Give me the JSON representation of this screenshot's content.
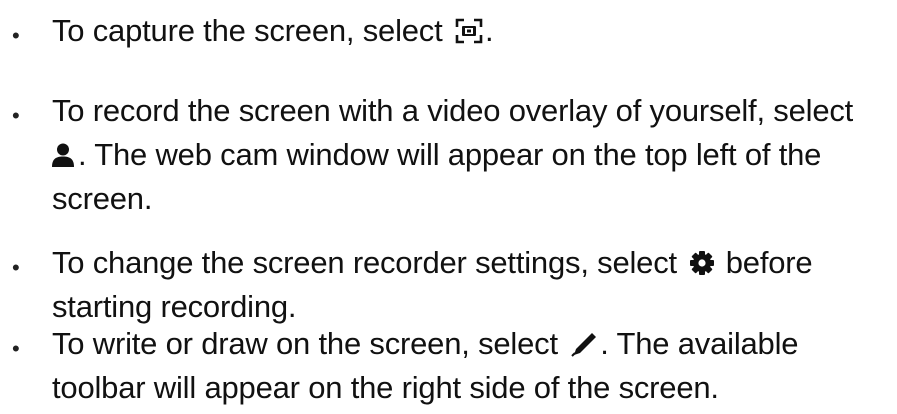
{
  "items": [
    {
      "icon": "screen-capture-icon",
      "lines": [
        {
          "before": "To capture the screen, select ",
          "after": "."
        }
      ]
    },
    {
      "icon": "person-icon",
      "lines": [
        {
          "text": "To record the screen with a video overlay of yourself, select"
        },
        {
          "before": "",
          "after": ". The web cam window will appear on the top left of the"
        },
        {
          "text": "screen."
        }
      ]
    },
    {
      "icon": "gear-icon",
      "lines": [
        {
          "before": "To change the screen recorder settings, select ",
          "after": " before"
        },
        {
          "text": "starting recording."
        }
      ]
    },
    {
      "icon": "pen-icon",
      "lines": [
        {
          "before": "To write or draw on the screen, select ",
          "after": ". The available"
        },
        {
          "text": "toolbar will appear on the right side of the screen."
        }
      ]
    }
  ],
  "bullet_char": "•"
}
